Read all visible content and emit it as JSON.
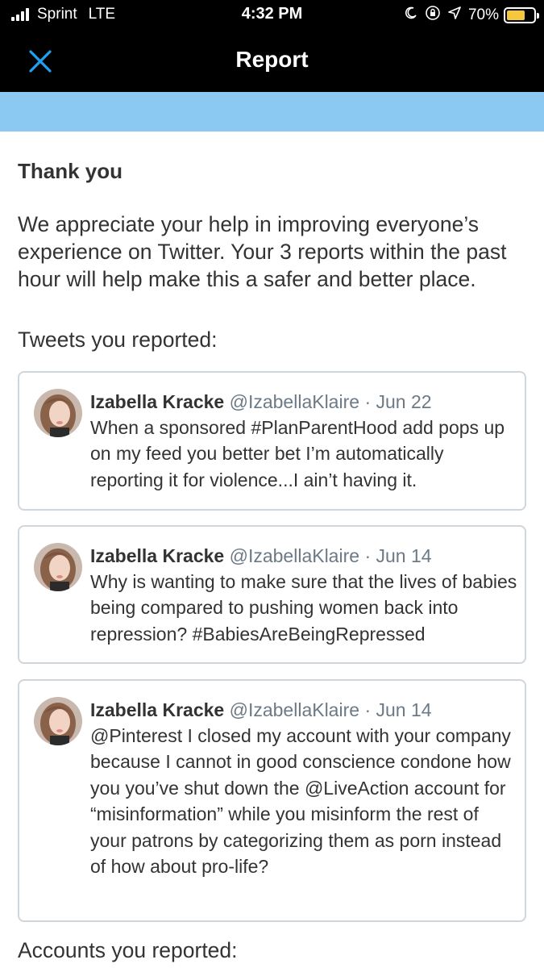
{
  "status_bar": {
    "carrier": "Sprint",
    "network": "LTE",
    "time": "4:32 PM",
    "battery_percent": "70%",
    "battery_level": 0.7,
    "battery_color": "#f6c73b"
  },
  "nav": {
    "title": "Report",
    "close_icon": "close-icon",
    "accent_color": "#1da1f2"
  },
  "banner_color": "#8bc8f2",
  "content": {
    "heading": "Thank you",
    "message": "We appreciate your help in improving everyone’s experience on Twitter. Your 3 reports within the past hour will help make this a safer and better place.",
    "tweets_label": "Tweets you reported:",
    "accounts_label": "Accounts you reported:"
  },
  "tweets": [
    {
      "name": "Izabella Kracke",
      "handle": "@IzabellaKlaire",
      "separator": "·",
      "date": "Jun 22",
      "text": "When a sponsored #PlanParentHood add pops up on my feed you better bet I’m automatically reporting it for violence...I ain’t having it."
    },
    {
      "name": "Izabella Kracke",
      "handle": "@IzabellaKlaire",
      "separator": "·",
      "date": "Jun 14",
      "text": "Why is wanting to make sure that the lives of babies being compared to pushing women back into repression? #BabiesAreBeingRepressed"
    },
    {
      "name": "Izabella Kracke",
      "handle": "@IzabellaKlaire",
      "separator": "·",
      "date": "Jun 14",
      "text": "@Pinterest I closed my account with your company because I cannot in good conscience condone how you you’ve shut down the @LiveAction account for “misinformation” while you misinform the rest of your patrons by categorizing them as porn instead of how about pro-life?"
    }
  ]
}
